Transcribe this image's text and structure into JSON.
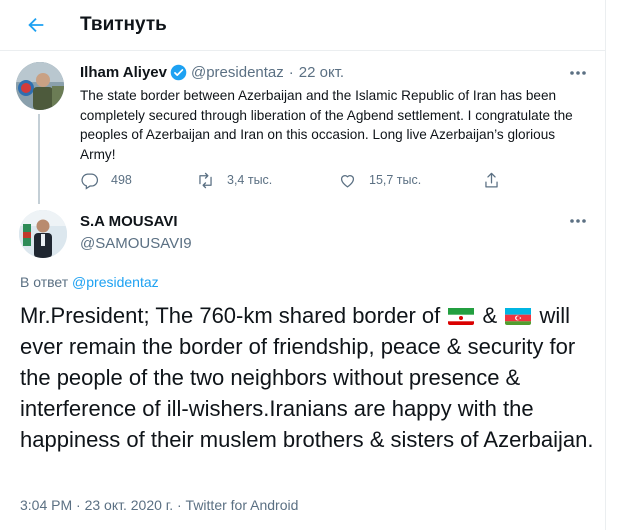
{
  "header": {
    "title": "Твитнуть"
  },
  "parent_tweet": {
    "display_name": "Ilham Aliyev",
    "handle": "@presidentaz",
    "separator": "·",
    "date": "22 окт.",
    "text": "The state border between Azerbaijan and the Islamic Republic of Iran has been completely secured through liberation of the Agbend settlement. I congratulate the peoples of Azerbaijan and Iran on this occasion. Long live Azerbaijan’s glorious Army!",
    "replies": "498",
    "retweets": "3,4 тыс.",
    "likes": "15,7 тыс."
  },
  "reply_tweet": {
    "display_name": "S.A MOUSAVI",
    "handle": "@SAMOUSAVI9",
    "in_reply_prefix": "В ответ",
    "in_reply_mention": "@presidentaz",
    "text_part1": "Mr.President; The 760-km shared border of",
    "text_amp1": "&",
    "text_part2": "will ever remain the border of friendship, peace & security for the people of the two neighbors without presence & interference of ill-wishers.Iranians are happy with the happiness of their muslem brothers & sisters of Azerbaijan.",
    "flags": [
      "flag-iran-icon",
      "flag-azerbaijan-icon"
    ],
    "time": "3:04 PM",
    "separator": "·",
    "date": "23 окт. 2020 г.",
    "source": "Twitter for Android"
  },
  "colors": {
    "accent": "#1da1f2",
    "secondary_text": "#5b7083",
    "verified": "#1da1f2"
  }
}
